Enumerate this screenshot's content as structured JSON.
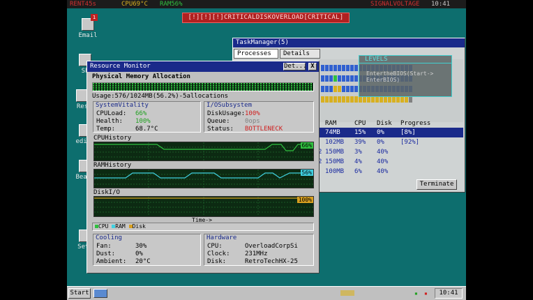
{
  "topbar": {
    "rent": "RENT45s",
    "cpu": "CPU69°C",
    "ram": "RAM56%",
    "signal": "SIGNALVOLTAGE",
    "clock": "10:41"
  },
  "alert": "[!][!][!]CRITICALDISKOVERLOAD[CRITICAL]",
  "desktop_icons": [
    {
      "label": "Email",
      "badge": "1"
    },
    {
      "label": "Sh"
    },
    {
      "label": "Res"
    },
    {
      "label": "edial"
    },
    {
      "label": "Beatn"
    },
    {
      "label": "Sett"
    }
  ],
  "task_manager": {
    "title": "TaskManager(5)",
    "tabs": [
      "Processes",
      "Details"
    ],
    "columns": [
      "RAM",
      "CPU",
      "Disk",
      "Progress"
    ],
    "rows": [
      {
        "pid": "",
        "ram": "74MB",
        "cpu": "15%",
        "disk": "0%",
        "progress": "[8%]",
        "selected": true
      },
      {
        "pid": "",
        "ram": "102MB",
        "cpu": "39%",
        "disk": "0%",
        "progress": "[92%]"
      },
      {
        "pid": "2",
        "ram": "150MB",
        "cpu": "3%",
        "disk": "40%",
        "progress": ""
      },
      {
        "pid": "2",
        "ram": "150MB",
        "cpu": "4%",
        "disk": "40%",
        "progress": ""
      },
      {
        "pid": "",
        "ram": "100MB",
        "cpu": "6%",
        "disk": "40%",
        "progress": ""
      }
    ],
    "terminate_label": "Terminate"
  },
  "levels": {
    "title": "LEVELS",
    "line1": "EntertheBIOS(Start->",
    "line2": "EnterBIOS)"
  },
  "resource_monitor": {
    "title": "Resource Monitor",
    "details_label": "Det...",
    "close_label": "X",
    "physical_memory_title": "Physical Memory Allocation",
    "usage_text": "Usage:576/1024MB(56.2%)-5allocations",
    "system_vitality": {
      "title": "SystemVitality",
      "cpu_load_label": "CPULoad:",
      "cpu_load_value": "66%",
      "health_label": "Health:",
      "health_value": "100%",
      "temp_label": "Temp:",
      "temp_value": "68.7°C"
    },
    "io_subsystem": {
      "title": "I/OSubsystem",
      "disk_usage_label": "DiskUsage:",
      "disk_usage_value": "100%",
      "queue_label": "Queue:",
      "queue_value": "0ops",
      "status_label": "Status:",
      "status_value": "BOTTLENECK"
    },
    "cpu_history": {
      "label": "CPUHistory",
      "value": "66%",
      "percent": 66
    },
    "ram_history": {
      "label": "RAMHistory",
      "value": "56%",
      "percent": 56
    },
    "disk_io": {
      "label": "DiskI/O",
      "value": "100%",
      "percent": 100
    },
    "time_axis": "Time->",
    "legend": [
      "CPU",
      "RAM",
      "Disk"
    ],
    "cooling": {
      "title": "Cooling",
      "fan_label": "Fan:",
      "fan_value": "30%",
      "dust_label": "Dust:",
      "dust_value": "0%",
      "ambient_label": "Ambient:",
      "ambient_value": "20°C"
    },
    "hardware": {
      "title": "Hardware",
      "cpu_label": "CPU:",
      "cpu_value": "OverloadCorpSi",
      "clock_label": "Clock:",
      "clock_value": "231MHz",
      "disk_label": "Disk:",
      "disk_value": "RetroTechHX-25"
    }
  },
  "taskbar": {
    "start_label": "Start",
    "clock": "10:41"
  },
  "colors": {
    "desktop": "#0d6e6e",
    "titlebar": "#1a2a8a",
    "cpu": "#30c040",
    "ram": "#40d0e0",
    "disk": "#d8a020"
  }
}
